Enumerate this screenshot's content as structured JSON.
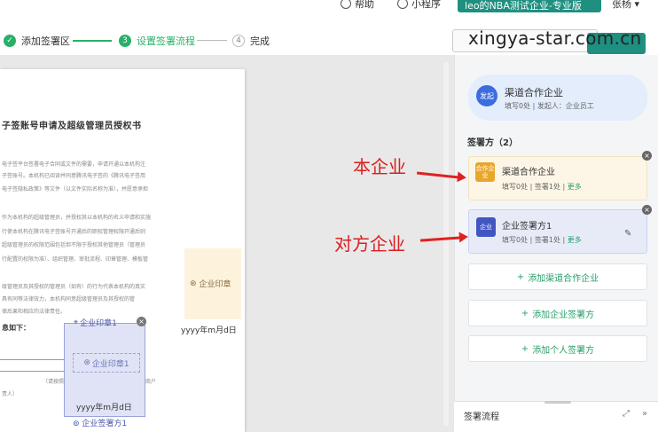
{
  "header": {
    "help_label": "帮助",
    "mini_program_label": "小程序",
    "enterprise_label": "leo的NBA测试企业-专业版",
    "user_name": "张杨",
    "accent_color": "#1f8f80"
  },
  "steps": [
    {
      "index": "✓",
      "label": "添加签署区",
      "state": "done"
    },
    {
      "index": "3",
      "label": "设置签署流程",
      "state": "active"
    },
    {
      "index": "4",
      "label": "完成",
      "state": "todo"
    }
  ],
  "watermark": "xingya-star.com.cn",
  "document": {
    "title": "子签账号申请及超级管理员授权书",
    "paragraphs": [
      "电子签平台签署电子合同或文件的需要，申请开通以本机构注",
      "子签账号。本机构已阅读并同意腾讯电子签的《腾讯电子签用",
      "电子签隐私政策》等文件（以文件实际名称为准），并愿意承担",
      "作为本机构的超级管理员，并授权其以本机构的名义申请和实施",
      "行使本机构在腾讯电子签账号开通后的职权管理权限开通后则",
      "超级管理员的权限范围包括但不限于授权其他管理员（管理员",
      "行配置的权限为准）、组织管理、审批流程、印章管理、模板管",
      "级管理员及其授权的管理员（如有）的行为代表本机构的真实",
      "具有同等法律效力，本机构同意超级管理员及其授权的管",
      "律后果和相应的法律责任。"
    ],
    "info_label": "息如下：",
    "note_line": "（请按照机构证件如实填写，分公司/个体工商户",
    "note_line2": "责人）",
    "seal_area_label": "企业印章",
    "date_right": "yyyy年m月d日",
    "sig_box": {
      "top_label": "企业印章1",
      "inner_label": "企业印章1",
      "date": "yyyy年m月d日",
      "bottom_label": "企业签署方1"
    }
  },
  "right_panel": {
    "initiator": {
      "badge": "发起",
      "name": "渠道合作企业",
      "sub": "填写0处 | 发起人：企业员工"
    },
    "signers_title": "签署方（2）",
    "signers": [
      {
        "badge": "合作企业",
        "name": "渠道合作企业",
        "sub": "填写0处 | 签署1处 | ",
        "more": "更多"
      },
      {
        "badge": "企业",
        "name": "企业签署方1",
        "sub": "填写0处 | 签署1处 | ",
        "more": "更多"
      }
    ],
    "add_buttons": [
      "添加渠道合作企业",
      "添加企业签署方",
      "添加个人签署方"
    ],
    "flow_title": "签署流程"
  },
  "annotations": {
    "own_company": "本企业",
    "other_company": "对方企业"
  }
}
